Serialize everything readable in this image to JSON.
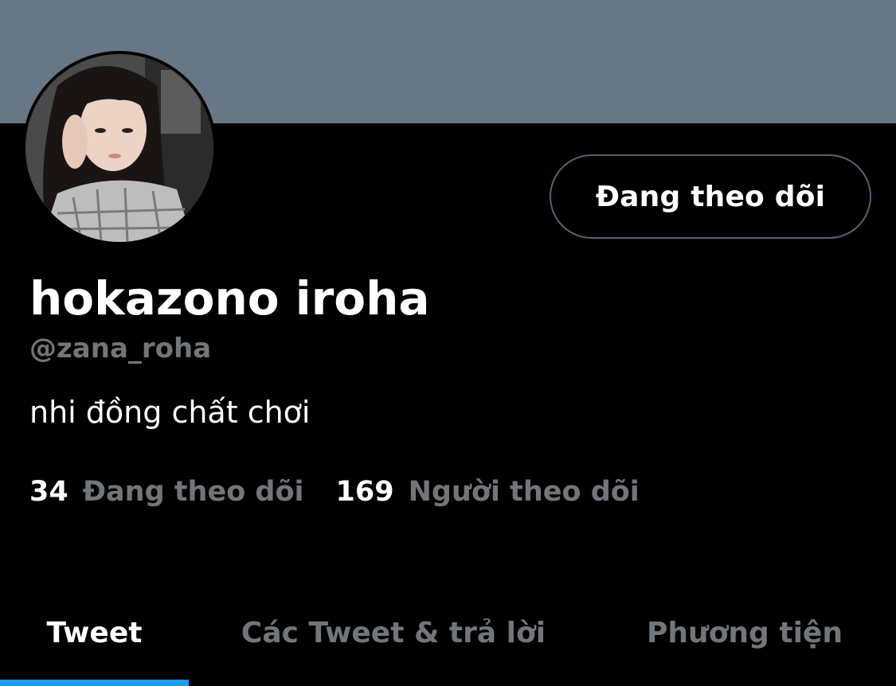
{
  "profile": {
    "display_name": "hokazono iroha",
    "handle": "@zana_roha",
    "bio": "nhi đồng chất chơi",
    "follow_button_label": "Đang theo dõi",
    "avatar_icon": "profile-photo"
  },
  "stats": {
    "following_count": "34",
    "following_label": "Đang theo dõi",
    "followers_count": "169",
    "followers_label": "Người theo dõi"
  },
  "tabs": [
    {
      "label": "Tweet",
      "active": true
    },
    {
      "label": "Các Tweet & trả lời",
      "active": false
    },
    {
      "label": "Phương tiện",
      "active": false
    }
  ],
  "colors": {
    "banner": "#687786",
    "background": "#000000",
    "secondary_text": "#71767b",
    "accent": "#1d9bf0",
    "button_border": "#536471"
  }
}
